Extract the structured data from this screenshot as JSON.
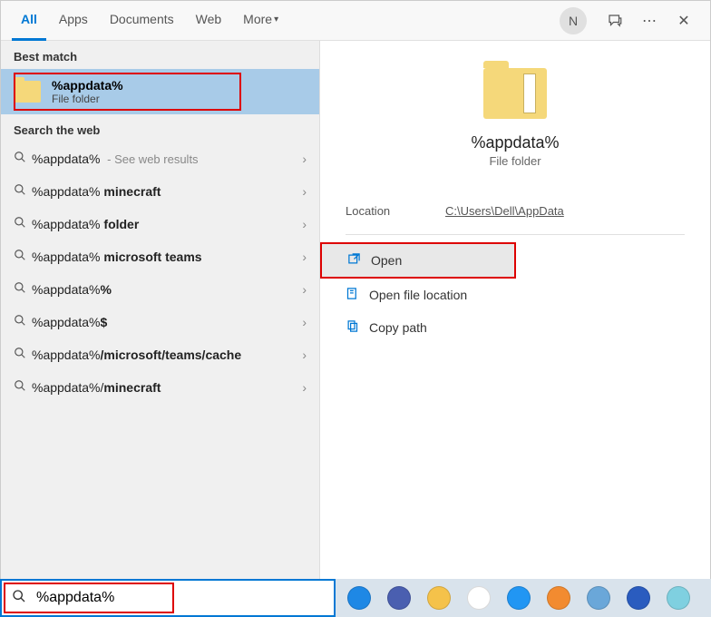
{
  "tabs": {
    "all": "All",
    "apps": "Apps",
    "documents": "Documents",
    "web": "Web",
    "more": "More"
  },
  "header": {
    "avatar_initial": "N"
  },
  "sections": {
    "best_match": "Best match",
    "search_web": "Search the web"
  },
  "best_match": {
    "title": "%appdata%",
    "subtitle": "File folder"
  },
  "suggestions": [
    {
      "plain": "%appdata%",
      "bold": "",
      "hint": " - See web results"
    },
    {
      "plain": "%appdata%",
      "bold": " minecraft",
      "hint": ""
    },
    {
      "plain": "%appdata%",
      "bold": " folder",
      "hint": ""
    },
    {
      "plain": "%appdata%",
      "bold": " microsoft teams",
      "hint": ""
    },
    {
      "plain": "%appdata%",
      "bold": "%",
      "hint": ""
    },
    {
      "plain": "%appdata%",
      "bold": "$",
      "hint": ""
    },
    {
      "plain": "%appdata%",
      "bold": "/microsoft/teams/cache",
      "hint": ""
    },
    {
      "plain": "%appdata%/",
      "bold": "minecraft",
      "hint": ""
    }
  ],
  "preview": {
    "title": "%appdata%",
    "subtitle": "File folder",
    "location_label": "Location",
    "location_value": "C:\\Users\\Dell\\AppData"
  },
  "actions": {
    "open": "Open",
    "open_loc": "Open file location",
    "copy_path": "Copy path"
  },
  "search": {
    "value": "%appdata%"
  },
  "taskbar_colors": [
    "#1e88e5",
    "#4a5fb0",
    "#f5c24a",
    "#ffffff",
    "#2196f3",
    "#f28b30",
    "#6aa7d9",
    "#2a5cbf",
    "#7fd0e0"
  ]
}
